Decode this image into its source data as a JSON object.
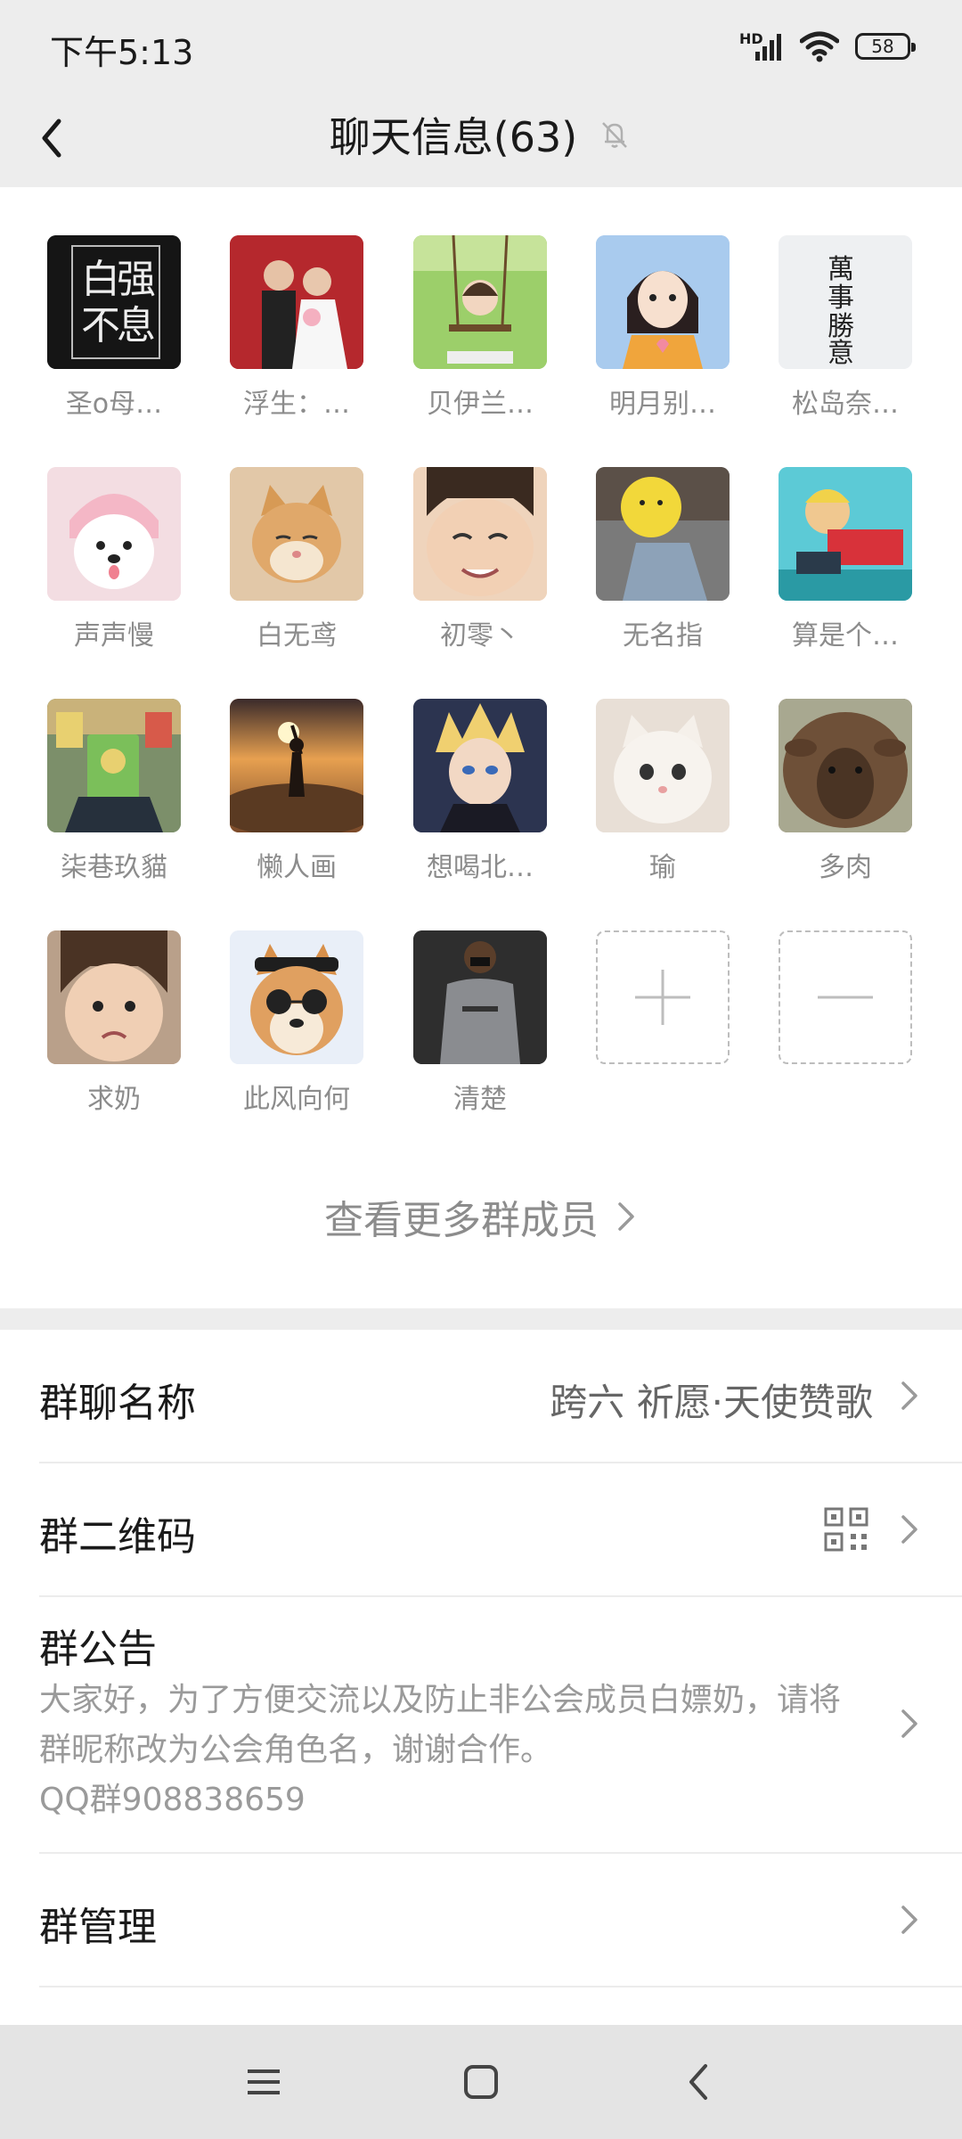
{
  "status_bar": {
    "time": "下午5:13",
    "network_label": "HD",
    "battery": "58",
    "icons": [
      "signal-icon",
      "wifi-icon",
      "battery-icon"
    ]
  },
  "header": {
    "title": "聊天信息(63)",
    "back_icon": "chevron-left-icon",
    "mute_icon": "bell-off-icon"
  },
  "members": [
    {
      "name": "圣o母…",
      "avatar": "calligraphy-avatar",
      "bg": "#1e1e1e"
    },
    {
      "name": "浮生：…",
      "avatar": "wedding-photo-avatar",
      "bg": "#b5282d"
    },
    {
      "name": "贝伊兰…",
      "avatar": "anime-swing-avatar",
      "bg": "#8cc35a"
    },
    {
      "name": "明月别…",
      "avatar": "anime-girl-heart-avatar",
      "bg": "#9fc3ea"
    },
    {
      "name": "松岛奈…",
      "avatar": "calligraphy-light-avatar",
      "bg": "#eef0f2"
    },
    {
      "name": "声声慢",
      "avatar": "dog-pink-hat-avatar",
      "bg": "#f2d7dd"
    },
    {
      "name": "白无鸢",
      "avatar": "cat-avatar",
      "bg": "#d8b48c"
    },
    {
      "name": "初零丶",
      "avatar": "child-face-avatar",
      "bg": "#e9c7aa"
    },
    {
      "name": "无名指",
      "avatar": "emoji-head-avatar",
      "bg": "#6e6e6e"
    },
    {
      "name": "算是个…",
      "avatar": "cartoon-character-avatar",
      "bg": "#50c8d2"
    },
    {
      "name": "柒巷玖貓",
      "avatar": "snack-photo-avatar",
      "bg": "#6b8a5a"
    },
    {
      "name": "懒人画",
      "avatar": "sunset-silhouette-avatar",
      "bg": "#c0753a"
    },
    {
      "name": "想喝北…",
      "avatar": "anime-ninja-avatar",
      "bg": "#2a3450"
    },
    {
      "name": "瑜",
      "avatar": "white-cat-avatar",
      "bg": "#eae3dc"
    },
    {
      "name": "多肉",
      "avatar": "sheep-avatar",
      "bg": "#7b5e44"
    },
    {
      "name": "求奶",
      "avatar": "crying-child-avatar",
      "bg": "#b99b83"
    },
    {
      "name": "此风向何",
      "avatar": "shiba-sunglasses-avatar",
      "bg": "#e8eef8"
    },
    {
      "name": "清楚",
      "avatar": "man-hoodie-avatar",
      "bg": "#3a3a3a"
    }
  ],
  "add_member_icon": "plus-icon",
  "remove_member_icon": "minus-icon",
  "see_more_label": "查看更多群成员",
  "settings": {
    "group_name_label": "群聊名称",
    "group_name_value": "跨六 祈愿·天使赞歌",
    "qr_label": "群二维码",
    "notice_label": "群公告",
    "notice_text": "大家好，为了方便交流以及防止非公会成员白嫖奶，请将群昵称改为公会角色名，谢谢合作。",
    "notice_qq": "QQ群908838659",
    "manage_label": "群管理"
  },
  "nav_bar": {
    "icons": [
      "menu-icon",
      "home-icon",
      "back-icon"
    ]
  }
}
